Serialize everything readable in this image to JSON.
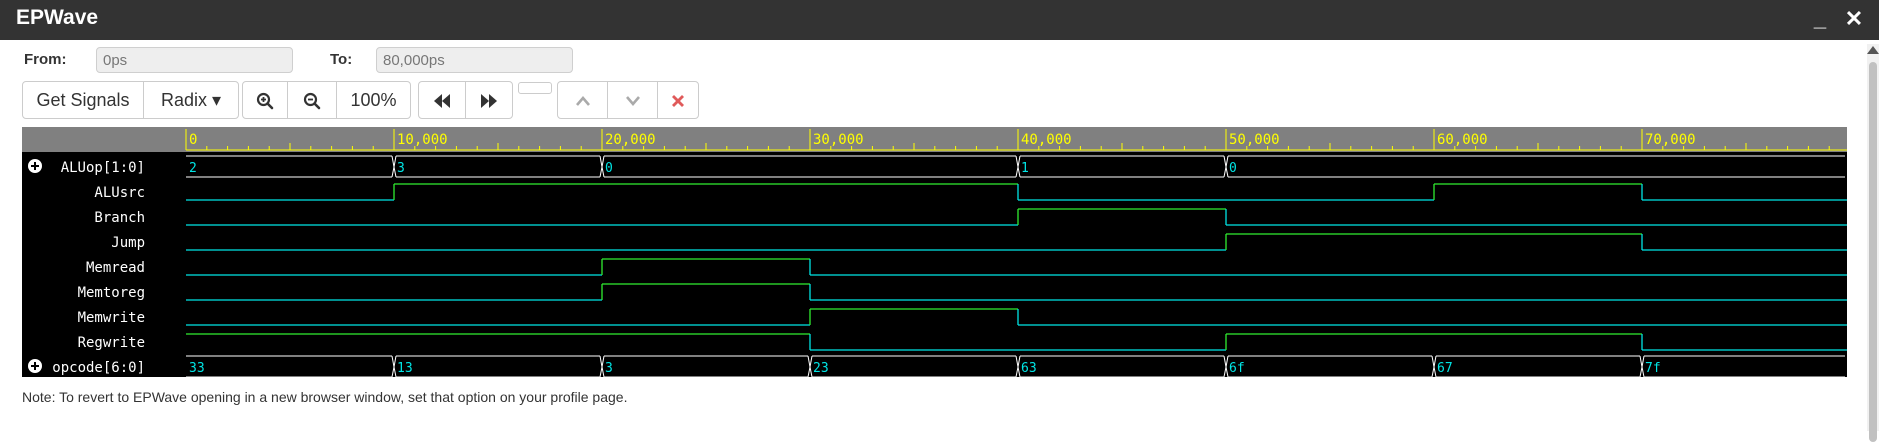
{
  "window": {
    "title": "EPWave",
    "minimize_glyph": "_",
    "close_glyph": "✕"
  },
  "range": {
    "from_label": "From:",
    "from_value": "0ps",
    "to_label": "To:",
    "to_value": "80,000ps"
  },
  "toolbar": {
    "get_signals": "Get Signals",
    "radix": "Radix ▾",
    "zoom_level": "100%",
    "icons": [
      "zoom-in-icon",
      "zoom-out-icon",
      "rewind-icon",
      "fast-forward-icon",
      "chevron-up-icon",
      "chevron-down-icon",
      "close-icon"
    ]
  },
  "colors": {
    "signal": "#00e5e5",
    "transition": "#30ee30",
    "ruler_text": "#ffff00",
    "label": "#ffffff"
  },
  "timeline": {
    "unit": "ps",
    "start": 0,
    "end": 80000,
    "ticks": [
      "0",
      "10,000",
      "20,000",
      "30,000",
      "40,000",
      "50,000",
      "60,000",
      "70,000"
    ],
    "tick_values": [
      0,
      10000,
      20000,
      30000,
      40000,
      50000,
      60000,
      70000
    ]
  },
  "signals": [
    {
      "name": "ALUop[1:0]",
      "type": "bus",
      "expandable": true,
      "segments": [
        {
          "t": 0,
          "v": "2"
        },
        {
          "t": 10000,
          "v": "3"
        },
        {
          "t": 20000,
          "v": "0"
        },
        {
          "t": 40000,
          "v": "1"
        },
        {
          "t": 50000,
          "v": "0"
        }
      ]
    },
    {
      "name": "ALUsrc",
      "type": "bit",
      "changes": [
        {
          "t": 0,
          "v": 0
        },
        {
          "t": 10000,
          "v": 1
        },
        {
          "t": 40000,
          "v": 0
        },
        {
          "t": 60000,
          "v": 1
        },
        {
          "t": 70000,
          "v": 0
        }
      ]
    },
    {
      "name": "Branch",
      "type": "bit",
      "changes": [
        {
          "t": 0,
          "v": 0
        },
        {
          "t": 40000,
          "v": 1
        },
        {
          "t": 50000,
          "v": 0
        }
      ]
    },
    {
      "name": "Jump",
      "type": "bit",
      "changes": [
        {
          "t": 0,
          "v": 0
        },
        {
          "t": 50000,
          "v": 1
        },
        {
          "t": 70000,
          "v": 0
        }
      ]
    },
    {
      "name": "Memread",
      "type": "bit",
      "changes": [
        {
          "t": 0,
          "v": 0
        },
        {
          "t": 20000,
          "v": 1
        },
        {
          "t": 30000,
          "v": 0
        }
      ]
    },
    {
      "name": "Memtoreg",
      "type": "bit",
      "changes": [
        {
          "t": 0,
          "v": 0
        },
        {
          "t": 20000,
          "v": 1
        },
        {
          "t": 30000,
          "v": 0
        }
      ]
    },
    {
      "name": "Memwrite",
      "type": "bit",
      "changes": [
        {
          "t": 0,
          "v": 0
        },
        {
          "t": 30000,
          "v": 1
        },
        {
          "t": 40000,
          "v": 0
        }
      ]
    },
    {
      "name": "Regwrite",
      "type": "bit",
      "changes": [
        {
          "t": 0,
          "v": 1
        },
        {
          "t": 30000,
          "v": 0
        },
        {
          "t": 50000,
          "v": 1
        },
        {
          "t": 70000,
          "v": 0
        }
      ]
    },
    {
      "name": "opcode[6:0]",
      "type": "bus",
      "expandable": true,
      "segments": [
        {
          "t": 0,
          "v": "33"
        },
        {
          "t": 10000,
          "v": "13"
        },
        {
          "t": 20000,
          "v": "3"
        },
        {
          "t": 30000,
          "v": "23"
        },
        {
          "t": 40000,
          "v": "63"
        },
        {
          "t": 50000,
          "v": "6f"
        },
        {
          "t": 60000,
          "v": "67"
        },
        {
          "t": 70000,
          "v": "7f"
        }
      ]
    }
  ],
  "note": "Note: To revert to EPWave opening in a new browser window, set that option on your profile page."
}
